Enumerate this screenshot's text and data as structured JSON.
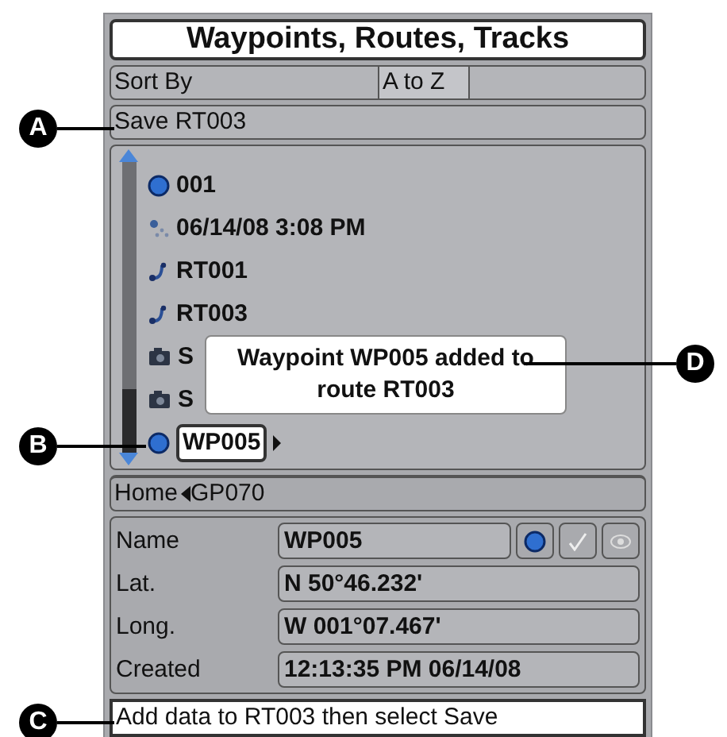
{
  "title": "Waypoints, Routes, Tracks",
  "sort": {
    "label": "Sort By",
    "value": "A to Z"
  },
  "save": {
    "label": "Save RT003"
  },
  "list": {
    "items": [
      {
        "kind": "waypoint",
        "label": "001",
        "selected": false
      },
      {
        "kind": "track",
        "label": "06/14/08 3:08 PM",
        "selected": false
      },
      {
        "kind": "route",
        "label": "RT001",
        "selected": false
      },
      {
        "kind": "route",
        "label": "RT003",
        "selected": false
      },
      {
        "kind": "photo",
        "label": "S",
        "selected": false
      },
      {
        "kind": "photo",
        "label": "S",
        "selected": false
      },
      {
        "kind": "waypoint",
        "label": "WP005",
        "selected": true
      }
    ],
    "popup": "Waypoint WP005 added to route RT003"
  },
  "breadcrumb": {
    "home": "Home",
    "current": "GP070"
  },
  "details": [
    {
      "label": "Name",
      "value": "WP005"
    },
    {
      "label": "Lat.",
      "value": "N 50°46.232'"
    },
    {
      "label": "Long.",
      "value": "W 001°07.467'"
    },
    {
      "label": "Created",
      "value": "12:13:35 PM 06/14/08"
    }
  ],
  "status": "Add data to RT003 then select Save",
  "callouts": [
    "A",
    "B",
    "C",
    "D"
  ]
}
